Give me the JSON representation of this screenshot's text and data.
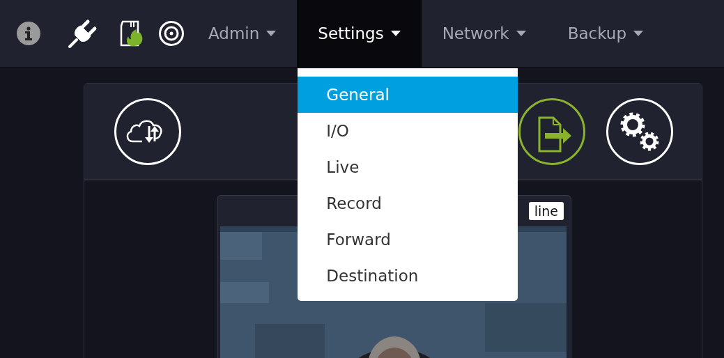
{
  "navbar": {
    "icons": [
      {
        "kind": "info"
      },
      {
        "kind": "plug"
      },
      {
        "kind": "card-fire"
      },
      {
        "kind": "target"
      }
    ],
    "menus": [
      {
        "label": "Admin",
        "selected": false
      },
      {
        "label": "Settings",
        "selected": true,
        "dropdown": [
          {
            "label": "General",
            "selected": true
          },
          {
            "label": "I/O",
            "selected": false
          },
          {
            "label": "Live",
            "selected": false
          },
          {
            "label": "Record",
            "selected": false
          },
          {
            "label": "Forward",
            "selected": false
          },
          {
            "label": "Destination",
            "selected": false
          }
        ]
      },
      {
        "label": "Network",
        "selected": false
      },
      {
        "label": "Backup",
        "selected": false
      }
    ]
  },
  "panel": {
    "actions": [
      {
        "kind": "cloud-sync"
      },
      {
        "kind": "file-export"
      },
      {
        "kind": "gears"
      }
    ],
    "stream": {
      "status": "line"
    }
  }
}
